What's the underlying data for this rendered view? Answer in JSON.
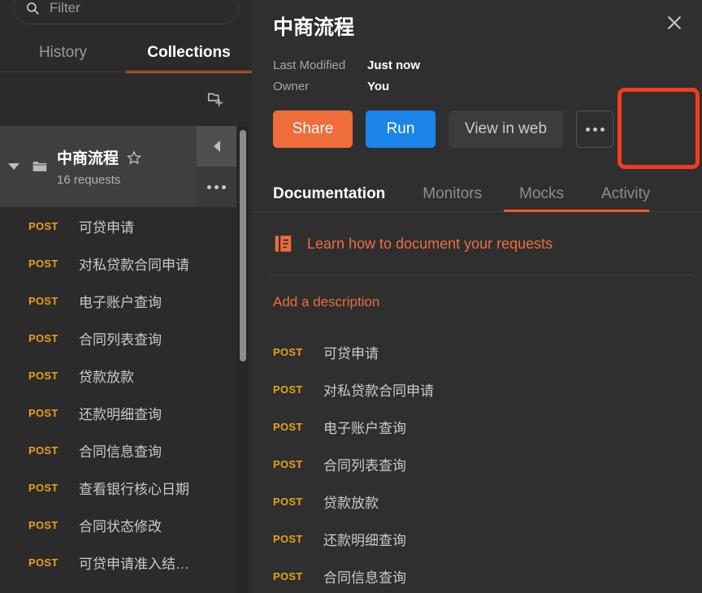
{
  "sidebar": {
    "filter": {
      "value": "",
      "placeholder": "Filter",
      "icon": "search-icon"
    },
    "tabs": [
      {
        "label": "History",
        "active": false
      },
      {
        "label": "Collections",
        "active": true
      }
    ],
    "new_collection_icon": "new-collection-icon",
    "collection": {
      "name": "中商流程",
      "requests_count": "16 requests",
      "star_icon": "star-outline-icon",
      "folder_icon": "folder-icon",
      "caret_icon": "caret-down-icon",
      "collapse_icon": "caret-left-icon",
      "more_icon": "more-horizontal-icon",
      "row_highlight_color": "#3f3f3f"
    },
    "requests": [
      {
        "method": "POST",
        "name": "可贷申请"
      },
      {
        "method": "POST",
        "name": "对私贷款合同申请"
      },
      {
        "method": "POST",
        "name": "电子账户查询"
      },
      {
        "method": "POST",
        "name": "合同列表查询"
      },
      {
        "method": "POST",
        "name": "贷款放款"
      },
      {
        "method": "POST",
        "name": "还款明细查询"
      },
      {
        "method": "POST",
        "name": "合同信息查询"
      },
      {
        "method": "POST",
        "name": "查看银行核心日期"
      },
      {
        "method": "POST",
        "name": "合同状态修改"
      },
      {
        "method": "POST",
        "name": "可贷申请准入结…"
      }
    ]
  },
  "panel": {
    "title": "中商流程",
    "close_icon": "close-icon",
    "meta": [
      {
        "key": "Last Modified",
        "value": "Just now"
      },
      {
        "key": "Owner",
        "value": "You"
      }
    ],
    "buttons": {
      "share": "Share",
      "run": "Run",
      "view_in_web": "View in web",
      "more_icon": "more-horizontal-icon"
    },
    "annotation": {
      "target": "Run",
      "color": "#f23b1e"
    },
    "tabs": [
      {
        "label": "Documentation",
        "active": true
      },
      {
        "label": "Monitors",
        "active": false
      },
      {
        "label": "Mocks",
        "active": false
      },
      {
        "label": "Activity",
        "active": false
      }
    ],
    "learn_link": {
      "text": "Learn how to document your requests",
      "icon": "book-icon"
    },
    "add_description": "Add a description",
    "doc_requests": [
      {
        "method": "POST",
        "name": "可贷申请"
      },
      {
        "method": "POST",
        "name": "对私贷款合同申请"
      },
      {
        "method": "POST",
        "name": "电子账户查询"
      },
      {
        "method": "POST",
        "name": "合同列表查询"
      },
      {
        "method": "POST",
        "name": "贷款放款"
      },
      {
        "method": "POST",
        "name": "还款明细查询"
      },
      {
        "method": "POST",
        "name": "合同信息查询"
      }
    ]
  },
  "colors": {
    "accent_orange": "#ef5b25",
    "share_orange": "#ef6c3b",
    "run_blue": "#1a84eb",
    "method_post": "#e6a117",
    "annotation_red": "#f23b1e",
    "sidebar_bg": "#2b2b2b",
    "panel_bg": "#2f2f2f"
  }
}
